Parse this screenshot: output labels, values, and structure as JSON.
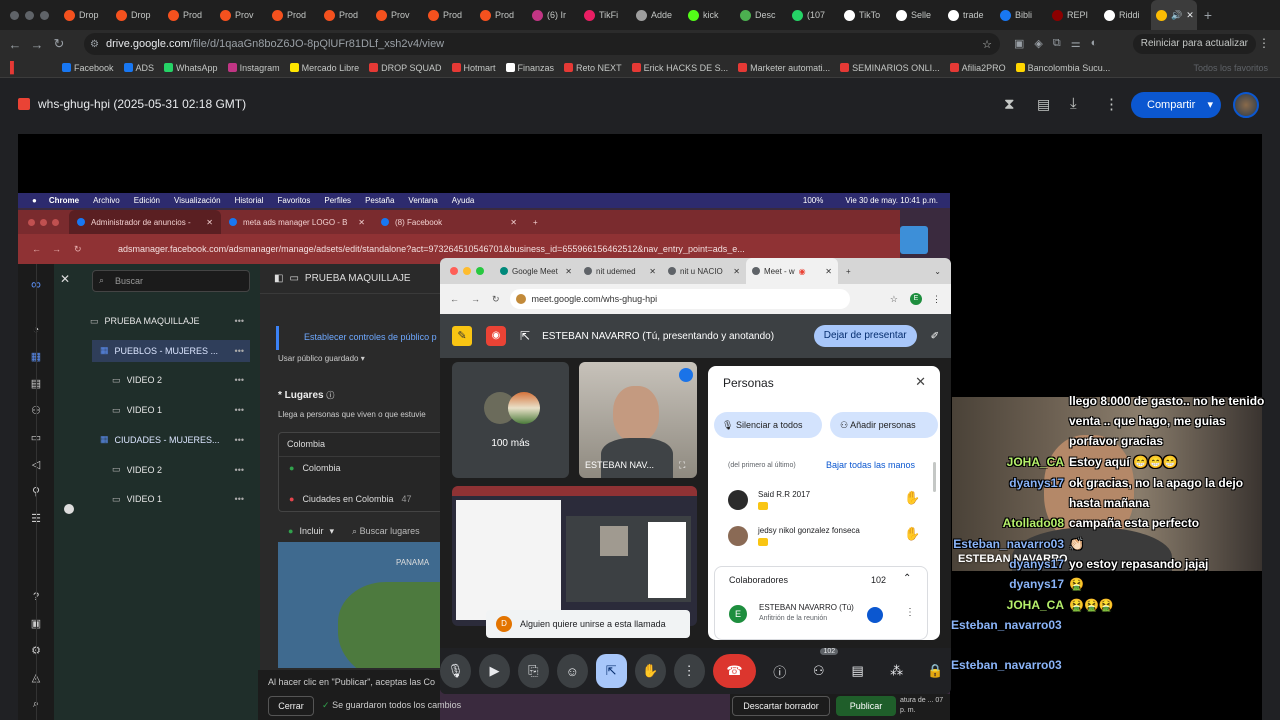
{
  "outer_tabs": [
    {
      "label": "Drop",
      "color": "#f4511e"
    },
    {
      "label": "Drop",
      "color": "#f4511e"
    },
    {
      "label": "Prod",
      "color": "#f4511e"
    },
    {
      "label": "Prov",
      "color": "#f4511e"
    },
    {
      "label": "Prod",
      "color": "#f4511e"
    },
    {
      "label": "Prod",
      "color": "#f4511e"
    },
    {
      "label": "Prov",
      "color": "#f4511e"
    },
    {
      "label": "Prod",
      "color": "#f4511e"
    },
    {
      "label": "Prod",
      "color": "#f4511e"
    },
    {
      "label": "(6) Ir",
      "color": "#c13584"
    },
    {
      "label": "TikFi",
      "color": "#e91e63"
    },
    {
      "label": "Adde",
      "color": "#9e9e9e"
    },
    {
      "label": "kick",
      "color": "#53fc18"
    },
    {
      "label": "Desc",
      "color": "#4caf50"
    },
    {
      "label": "(107",
      "color": "#25d366"
    },
    {
      "label": "TikTo",
      "color": "#ffffff"
    },
    {
      "label": "Selle",
      "color": "#ffffff"
    },
    {
      "label": "trade",
      "color": "#ffffff"
    },
    {
      "label": "Bibli",
      "color": "#1877f2"
    },
    {
      "label": "REPI",
      "color": "#8b0000"
    },
    {
      "label": "Riddi",
      "color": "#ffffff"
    }
  ],
  "url": {
    "domain": "drive.google.com",
    "path": "/file/d/1qaaGn8boZ6JO-8pQlUFr81DLf_xsh2v4/view"
  },
  "restart_label": "Reiniciar para actualizar",
  "bookmarks": [
    {
      "label": "Facebook",
      "color": "#1877f2"
    },
    {
      "label": "ADS",
      "color": "#1877f2"
    },
    {
      "label": "WhatsApp",
      "color": "#25d366"
    },
    {
      "label": "Instagram",
      "color": "#c13584"
    },
    {
      "label": "Mercado Libre",
      "color": "#ffe600"
    },
    {
      "label": "DROP SQUAD",
      "color": "#e53935"
    },
    {
      "label": "Hotmart",
      "color": "#e53935"
    },
    {
      "label": "Finanzas",
      "color": "#ffffff"
    },
    {
      "label": "Reto NEXT",
      "color": "#e53935"
    },
    {
      "label": "Erick HACKS DE S...",
      "color": "#e53935"
    },
    {
      "label": "Marketer automati...",
      "color": "#e53935"
    },
    {
      "label": "SEMINARIOS ONLI...",
      "color": "#e53935"
    },
    {
      "label": "Afilia2PRO",
      "color": "#e53935"
    },
    {
      "label": "Bancolombia Sucu...",
      "color": "#ffd600"
    }
  ],
  "all_bookmarks_label": "Todos los favoritos",
  "doc_title": "whs-ghug-hpi (2025-05-31 02:18 GMT)",
  "share_label": "Compartir",
  "mac_menu": [
    "Chrome",
    "Archivo",
    "Edición",
    "Visualización",
    "Historial",
    "Favoritos",
    "Perfiles",
    "Pestaña",
    "Ventana",
    "Ayuda"
  ],
  "mac_status": {
    "battery": "100%",
    "datetime": "Vie 30 de may.  10:41 p.m."
  },
  "fb_tabs": [
    "Administrador de anuncios -",
    "meta ads manager LOGO - B",
    "(8) Facebook"
  ],
  "fb_url": "adsmanager.facebook.com/adsmanager/manage/adsets/edit/standalone?act=973264510546701&business_id=655966156462512&nav_entry_point=ads_e...",
  "fb_search_placeholder": "Buscar",
  "fb_tree": [
    {
      "label": "PRUEBA MAQUILLAJE",
      "level": 0,
      "kind": "folder"
    },
    {
      "label": "PUEBLOS - MUJERES ...",
      "level": 1,
      "kind": "adset"
    },
    {
      "label": "VIDEO 2",
      "level": 2,
      "kind": "ad"
    },
    {
      "label": "VIDEO 1",
      "level": 2,
      "kind": "ad"
    },
    {
      "label": "CIUDADES - MUJERES...",
      "level": 1,
      "kind": "adset"
    },
    {
      "label": "VIDEO 2",
      "level": 2,
      "kind": "ad"
    },
    {
      "label": "VIDEO 1",
      "level": 2,
      "kind": "ad"
    }
  ],
  "fb_main": {
    "breadcrumb": "PRUEBA MAQUILLAJE",
    "controls_link": "Establecer controles de público p",
    "saved_audience": "Usar público guardado",
    "places_title": "* Lugares",
    "places_desc": "Llega a personas que viven o que estuvie",
    "country": "Colombia",
    "included": "Colombia",
    "excluded": "Ciudades en Colombia",
    "excluded_count": "47",
    "include_label": "Incluir",
    "search_places": "Buscar lugares",
    "map_label": "PANAMA",
    "publish_note": "Al hacer clic en \"Publicar\", aceptas las Co",
    "close_label": "Cerrar",
    "saved_note": "Se guardaron todos los cambios",
    "discard_label": "Descartar borrador",
    "publish_label": "Publicar",
    "notice": "atura de ... 07 p. m."
  },
  "meet_tabs": [
    "Google Meet",
    "nit udemed",
    "nit u NACIO",
    "Meet - w"
  ],
  "meet_url": "meet.google.com/whs-ghug-hpi",
  "presenting_label": "ESTEBAN NAVARRO (Tú, presentando y anotando)",
  "stop_present_label": "Dejar de presentar",
  "more_tile_label": "100 más",
  "presenter_tile_label": "ESTEBAN NAV...",
  "people_panel": {
    "title": "Personas",
    "mute_all": "Silenciar a todos",
    "add_people": "Añadir personas",
    "hands_order": "(del primero al último)",
    "lower_hands": "Bajar todas las manos",
    "raised": [
      {
        "name": "Said R.R 2017"
      },
      {
        "name": "jedsy nikol gonzalez fonseca"
      }
    ],
    "collaborators_label": "Colaboradores",
    "collaborators_count": "102",
    "host_name": "ESTEBAN NAVARRO (Tú)",
    "host_role": "Anfitrión de la reunión"
  },
  "join_request": "Alguien quiere unirse a esta llamada",
  "participants_badge": "102",
  "cam_name_label": "ESTEBAN NAVARRO",
  "chat": [
    {
      "user": "",
      "message": "llego 8.000 de gasto.. no he tenido",
      "user_color": "#ffffff"
    },
    {
      "user": "",
      "message": "venta .. que hago, me guias",
      "user_color": "#ffffff"
    },
    {
      "user": "",
      "message": "porfavor gracias",
      "user_color": "#ffffff"
    },
    {
      "user": "JOHA_CA",
      "message": "Estoy aquí 😁😁😁",
      "user_color": "#b6f06b"
    },
    {
      "user": "dyanys17",
      "message": "ok gracias, no la apago la dejo",
      "user_color": "#8ab4f8"
    },
    {
      "user": "",
      "message": "hasta mañana",
      "user_color": "#ffffff"
    },
    {
      "user": "Atollado08",
      "message": "campaña esta perfecto",
      "user_color": "#b6f06b"
    },
    {
      "user": "Esteban_navarro03",
      "message": "👏🏻",
      "user_color": "#8ab4f8"
    },
    {
      "user": "dyanys17",
      "message": "yo estoy repasando jajaj",
      "user_color": "#8ab4f8"
    },
    {
      "user": "dyanys17",
      "message": "🤮",
      "user_color": "#8ab4f8"
    },
    {
      "user": "JOHA_CA",
      "message": "🤮🤮🤮",
      "user_color": "#b6f06b"
    },
    {
      "user": "Esteban_navarro03",
      "message": "",
      "user_color": "#8ab4f8"
    },
    {
      "user": "Esteban_navarro03",
      "message": "",
      "user_color": "#8ab4f8"
    }
  ]
}
